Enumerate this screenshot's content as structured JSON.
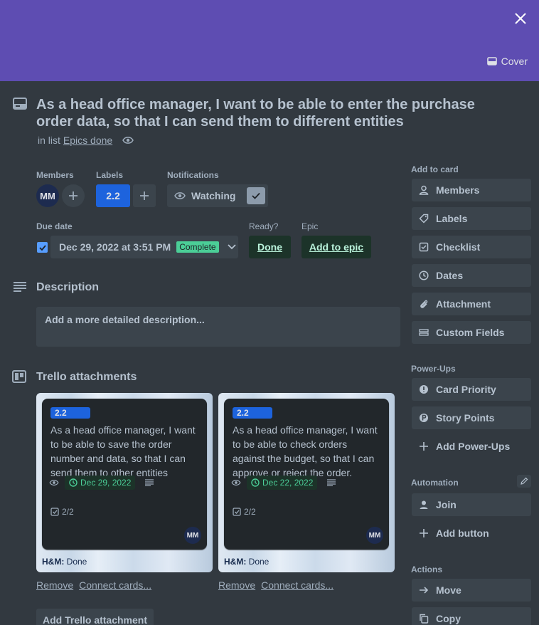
{
  "header": {
    "cover_label": "Cover"
  },
  "card": {
    "title": "As a head office manager, I want to be able to enter the purchase order data, so that I can send them to different entities",
    "in_list_prefix": "in list",
    "list_name": "Epics done"
  },
  "fields": {
    "members_label": "Members",
    "member_initials": "MM",
    "labels_label": "Labels",
    "label_value": "2.2",
    "notifications_label": "Notifications",
    "watching_label": "Watching",
    "due_date_label": "Due date",
    "due_date_value": "Dec 29, 2022 at 3:51 PM",
    "due_status": "Complete",
    "ready_label": "Ready?",
    "ready_value": "Done",
    "epic_label": "Epic",
    "epic_value": "Add to epic"
  },
  "description": {
    "title": "Description",
    "placeholder": "Add a more detailed description..."
  },
  "attachments": {
    "title": "Trello attachments",
    "cards": [
      {
        "label": "2.2",
        "text": "As a head office manager, I want to be able to save the order number and data, so that I can send them to other entities",
        "date": "Dec 29, 2022",
        "checklist": "2/2",
        "member": "MM",
        "board": "H&M:",
        "list": "Done"
      },
      {
        "label": "2.2",
        "text": "As a head office manager, I want to be able to check orders against the budget, so that I can approve or reject the order.",
        "date": "Dec 22, 2022",
        "checklist": "2/2",
        "member": "MM",
        "board": "H&M:",
        "list": "Done"
      }
    ],
    "remove_label": "Remove",
    "connect_label": "Connect cards...",
    "add_button": "Add Trello attachment"
  },
  "sidebar": {
    "add_to_card": "Add to card",
    "add_items": [
      "Members",
      "Labels",
      "Checklist",
      "Dates",
      "Attachment",
      "Custom Fields"
    ],
    "powerups_title": "Power-Ups",
    "powerups": [
      "Card Priority",
      "Story Points",
      "Add Power-Ups"
    ],
    "automation_title": "Automation",
    "automation": [
      "Join",
      "Add button"
    ],
    "actions_title": "Actions",
    "actions": [
      "Move",
      "Copy"
    ]
  }
}
